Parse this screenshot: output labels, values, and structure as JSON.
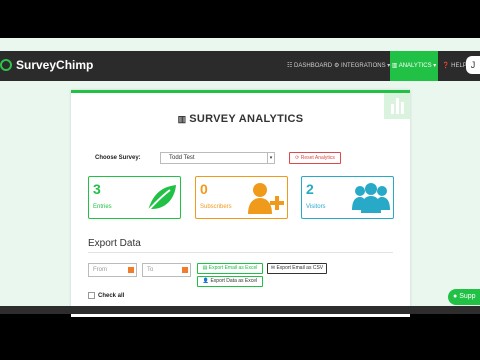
{
  "brand": {
    "name": "SurveyChimp"
  },
  "nav": {
    "dashboard": "☷ DASHBOARD",
    "integrations": "⚙ INTEGRATIONS ▾",
    "analytics": "▥ ANALYTICS ▾",
    "help": "❓ HELP ▾",
    "avatar": "J"
  },
  "page": {
    "title": "SURVEY ANALYTICS"
  },
  "survey": {
    "label": "Choose Survey:",
    "selected": "Todd Test",
    "reset_label": "Reset Analytics"
  },
  "stats": [
    {
      "value": "3",
      "label": "Entries",
      "color": "#21c146",
      "icon": "leaf-icon"
    },
    {
      "value": "0",
      "label": "Subscribers",
      "color": "#f09a1b",
      "icon": "add-user-icon"
    },
    {
      "value": "2",
      "label": "Visitors",
      "color": "#28a9c7",
      "icon": "users-icon"
    }
  ],
  "export": {
    "title": "Export Data",
    "from_placeholder": "From",
    "to_placeholder": "To",
    "email_excel": "Export Email as Excel",
    "email_csv": "Export Email as CSV",
    "data_excel": "Export Data as Excel",
    "check_all": "Check all"
  },
  "support": {
    "label": "Supp"
  }
}
